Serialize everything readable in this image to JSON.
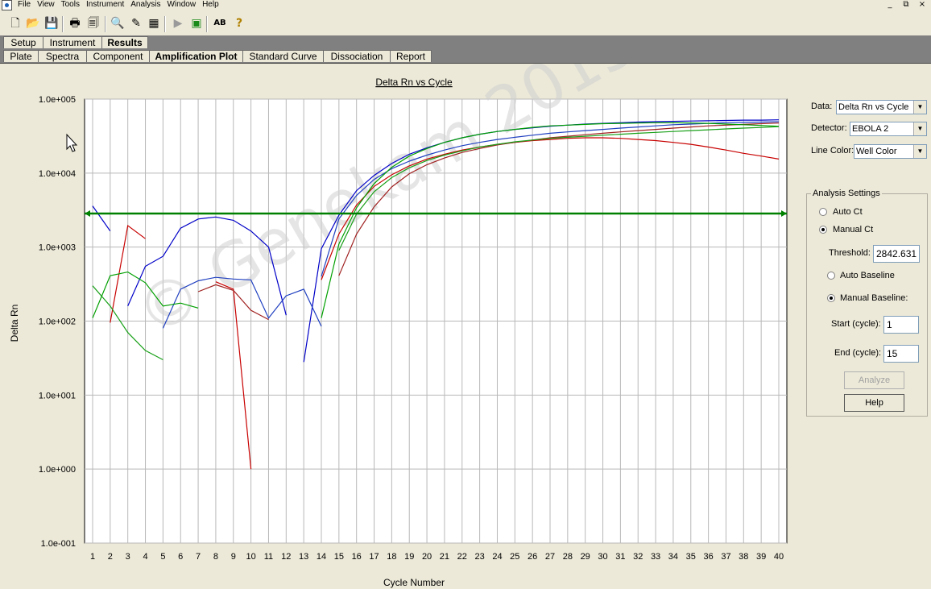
{
  "menu": {
    "items": [
      "File",
      "View",
      "Tools",
      "Instrument",
      "Analysis",
      "Window",
      "Help"
    ]
  },
  "window_controls": [
    "_",
    "⧉",
    "×"
  ],
  "toolbar": {
    "icons": [
      "new-document-icon",
      "open-folder-icon",
      "save-icon",
      "print-icon",
      "print-preview-icon",
      "zoom-icon",
      "edit-icon",
      "grid-icon",
      "run-icon",
      "run-ready-icon",
      "spelling-icon",
      "help-icon"
    ],
    "glyphs": [
      "🗋",
      "📂",
      "💾",
      "🖶",
      "🗐",
      "🔍",
      "✎",
      "▦",
      "▶",
      "▣",
      "AB",
      "?"
    ]
  },
  "main_tabs": [
    {
      "label": "Setup",
      "active": false
    },
    {
      "label": "Instrument",
      "active": false
    },
    {
      "label": "Results",
      "active": true
    }
  ],
  "sub_tabs": [
    {
      "label": "Plate",
      "active": false
    },
    {
      "label": "Spectra",
      "active": false
    },
    {
      "label": "Component",
      "active": false
    },
    {
      "label": "Amplification Plot",
      "active": true
    },
    {
      "label": "Standard Curve",
      "active": false
    },
    {
      "label": "Dissociation",
      "active": false
    },
    {
      "label": "Report",
      "active": false
    }
  ],
  "panel": {
    "data_label": "Data:",
    "data_value": "Delta Rn vs Cycle",
    "detector_label": "Detector:",
    "detector_value": "EBOLA 2",
    "line_color_label": "Line Color:",
    "line_color_value": "Well Color",
    "analysis_title": "Analysis Settings",
    "auto_ct": "Auto Ct",
    "manual_ct": "Manual Ct",
    "ct_mode": "manual",
    "threshold_label": "Threshold:",
    "threshold_value": "2842.631",
    "auto_baseline": "Auto Baseline",
    "manual_baseline": "Manual Baseline:",
    "baseline_mode": "manual",
    "start_label": "Start (cycle):",
    "start_value": "1",
    "end_label": "End (cycle):",
    "end_value": "15",
    "analyze_label": "Analyze",
    "help_label": "Help"
  },
  "watermark": "© Genekam 2015",
  "chart_data": {
    "type": "line",
    "title": "Delta Rn vs Cycle",
    "xlabel": "Cycle Number",
    "ylabel": "Delta Rn",
    "y_scale": "log",
    "ylim": [
      0.1,
      100000
    ],
    "xlim": [
      1,
      40
    ],
    "y_ticks": [
      "1.0e-001",
      "1.0e+000",
      "1.0e+001",
      "1.0e+002",
      "1.0e+003",
      "1.0e+004",
      "1.0e+005"
    ],
    "x_ticks": [
      1,
      2,
      3,
      4,
      5,
      6,
      7,
      8,
      9,
      10,
      11,
      12,
      13,
      14,
      15,
      16,
      17,
      18,
      19,
      20,
      21,
      22,
      23,
      24,
      25,
      26,
      27,
      28,
      29,
      30,
      31,
      32,
      33,
      34,
      35,
      36,
      37,
      38,
      39,
      40
    ],
    "grid": true,
    "threshold": 2842.631,
    "threshold_color": "#008000",
    "series": [
      {
        "color": "#0000c8",
        "segments": [
          [
            [
              1,
              3600
            ],
            [
              2,
              1650
            ]
          ],
          [
            [
              3,
              160
            ],
            [
              4,
              550
            ],
            [
              5,
              750
            ],
            [
              6,
              1800
            ],
            [
              7,
              2400
            ],
            [
              8,
              2550
            ],
            [
              9,
              2300
            ],
            [
              10,
              1650
            ],
            [
              11,
              1000
            ],
            [
              12,
              120
            ]
          ],
          [
            [
              13,
              28
            ],
            [
              14,
              950
            ],
            [
              15,
              2700
            ],
            [
              16,
              5800
            ],
            [
              17,
              9300
            ],
            [
              18,
              13500
            ],
            [
              19,
              18000
            ],
            [
              20,
              22000
            ],
            [
              21,
              26000
            ],
            [
              22,
              30000
            ],
            [
              23,
              33500
            ],
            [
              24,
              36500
            ],
            [
              25,
              39000
            ],
            [
              26,
              41000
            ],
            [
              27,
              43000
            ],
            [
              28,
              44500
            ],
            [
              29,
              46000
            ],
            [
              30,
              47000
            ],
            [
              31,
              48000
            ],
            [
              32,
              49000
            ],
            [
              33,
              49500
            ],
            [
              34,
              50000
            ],
            [
              35,
              50500
            ],
            [
              36,
              51000
            ],
            [
              37,
              51500
            ],
            [
              38,
              52000
            ],
            [
              39,
              52000
            ],
            [
              40,
              52500
            ]
          ]
        ]
      },
      {
        "color": "#2040c0",
        "segments": [
          [
            [
              5,
              80
            ],
            [
              6,
              270
            ],
            [
              7,
              350
            ],
            [
              8,
              390
            ],
            [
              9,
              370
            ],
            [
              10,
              360
            ],
            [
              11,
              110
            ],
            [
              12,
              220
            ],
            [
              13,
              270
            ],
            [
              14,
              85
            ]
          ],
          [
            [
              14,
              400
            ],
            [
              15,
              2400
            ],
            [
              16,
              5000
            ],
            [
              17,
              8200
            ],
            [
              18,
              11500
            ],
            [
              19,
              14500
            ],
            [
              20,
              17500
            ],
            [
              21,
              20500
            ],
            [
              22,
              23500
            ],
            [
              23,
              26000
            ],
            [
              24,
              28500
            ],
            [
              25,
              30500
            ],
            [
              26,
              32500
            ],
            [
              27,
              34500
            ],
            [
              28,
              36000
            ],
            [
              29,
              37500
            ],
            [
              30,
              39000
            ],
            [
              31,
              40500
            ],
            [
              32,
              42000
            ],
            [
              33,
              43500
            ],
            [
              34,
              45000
            ],
            [
              35,
              46000
            ],
            [
              36,
              47000
            ],
            [
              37,
              48000
            ],
            [
              38,
              48500
            ],
            [
              39,
              49000
            ],
            [
              40,
              49500
            ]
          ]
        ]
      },
      {
        "color": "#c80000",
        "segments": [
          [
            [
              2,
              95
            ],
            [
              3,
              1950
            ],
            [
              4,
              1300
            ]
          ],
          [
            [
              8,
              340
            ],
            [
              9,
              270
            ],
            [
              10,
              1
            ]
          ],
          [
            [
              14,
              360
            ],
            [
              15,
              1500
            ],
            [
              16,
              3700
            ],
            [
              17,
              6600
            ],
            [
              18,
              9500
            ],
            [
              19,
              12500
            ],
            [
              20,
              15500
            ],
            [
              21,
              18000
            ],
            [
              22,
              20500
            ],
            [
              23,
              22500
            ],
            [
              24,
              24500
            ],
            [
              25,
              26000
            ],
            [
              26,
              27500
            ],
            [
              27,
              28500
            ],
            [
              28,
              29500
            ],
            [
              29,
              30000
            ],
            [
              30,
              30000
            ],
            [
              31,
              29500
            ],
            [
              32,
              28500
            ],
            [
              33,
              27500
            ],
            [
              34,
              26000
            ],
            [
              35,
              24500
            ],
            [
              36,
              22500
            ],
            [
              37,
              20500
            ],
            [
              38,
              18500
            ],
            [
              39,
              17000
            ],
            [
              40,
              15500
            ]
          ]
        ]
      },
      {
        "color": "#a02020",
        "segments": [
          [
            [
              7,
              250
            ],
            [
              8,
              310
            ],
            [
              9,
              260
            ],
            [
              10,
              140
            ],
            [
              11,
              105
            ]
          ],
          [
            [
              15,
              410
            ],
            [
              16,
              1500
            ],
            [
              17,
              3500
            ],
            [
              18,
              6500
            ],
            [
              19,
              9800
            ],
            [
              20,
              13000
            ],
            [
              21,
              16000
            ],
            [
              22,
              19000
            ],
            [
              23,
              21500
            ],
            [
              24,
              24000
            ],
            [
              25,
              26000
            ],
            [
              26,
              28000
            ],
            [
              27,
              30000
            ],
            [
              28,
              31500
            ],
            [
              29,
              33000
            ],
            [
              30,
              34500
            ],
            [
              31,
              36000
            ],
            [
              32,
              37500
            ],
            [
              33,
              39000
            ],
            [
              34,
              40500
            ],
            [
              35,
              42000
            ],
            [
              36,
              43500
            ],
            [
              37,
              44500
            ],
            [
              38,
              45500
            ],
            [
              39,
              46500
            ],
            [
              40,
              47500
            ]
          ]
        ]
      },
      {
        "color": "#00a000",
        "segments": [
          [
            [
              1,
              110
            ],
            [
              2,
              410
            ],
            [
              3,
              460
            ],
            [
              4,
              330
            ],
            [
              5,
              160
            ],
            [
              6,
              175
            ],
            [
              7,
              150
            ]
          ],
          [
            [
              14,
              110
            ],
            [
              15,
              1100
            ],
            [
              16,
              3400
            ],
            [
              17,
              7200
            ],
            [
              18,
              12000
            ],
            [
              19,
              17000
            ],
            [
              20,
              21500
            ],
            [
              21,
              26000
            ],
            [
              22,
              30000
            ],
            [
              23,
              33500
            ],
            [
              24,
              36500
            ],
            [
              25,
              39000
            ],
            [
              26,
              41500
            ],
            [
              27,
              43500
            ],
            [
              28,
              44500
            ],
            [
              29,
              45500
            ],
            [
              30,
              46500
            ],
            [
              31,
              47000
            ],
            [
              32,
              47500
            ],
            [
              33,
              48000
            ],
            [
              34,
              48000
            ],
            [
              35,
              47500
            ],
            [
              36,
              47000
            ],
            [
              37,
              46000
            ],
            [
              38,
              45000
            ],
            [
              39,
              44000
            ],
            [
              40,
              43000
            ]
          ]
        ]
      },
      {
        "color": "#18a018",
        "segments": [
          [
            [
              1,
              300
            ],
            [
              2,
              160
            ],
            [
              3,
              70
            ],
            [
              4,
              40
            ],
            [
              5,
              30
            ]
          ],
          [
            [
              15,
              900
            ],
            [
              16,
              2800
            ],
            [
              17,
              5600
            ],
            [
              18,
              8700
            ],
            [
              19,
              11800
            ],
            [
              20,
              14800
            ],
            [
              21,
              17500
            ],
            [
              22,
              20000
            ],
            [
              23,
              22500
            ],
            [
              24,
              24500
            ],
            [
              25,
              26500
            ],
            [
              26,
              28000
            ],
            [
              27,
              29500
            ],
            [
              28,
              30500
            ],
            [
              29,
              31500
            ],
            [
              30,
              32500
            ],
            [
              31,
              33500
            ],
            [
              32,
              34500
            ],
            [
              33,
              35500
            ],
            [
              34,
              36500
            ],
            [
              35,
              37500
            ],
            [
              36,
              38500
            ],
            [
              37,
              39500
            ],
            [
              38,
              40500
            ],
            [
              39,
              41500
            ],
            [
              40,
              42500
            ]
          ]
        ]
      }
    ]
  }
}
